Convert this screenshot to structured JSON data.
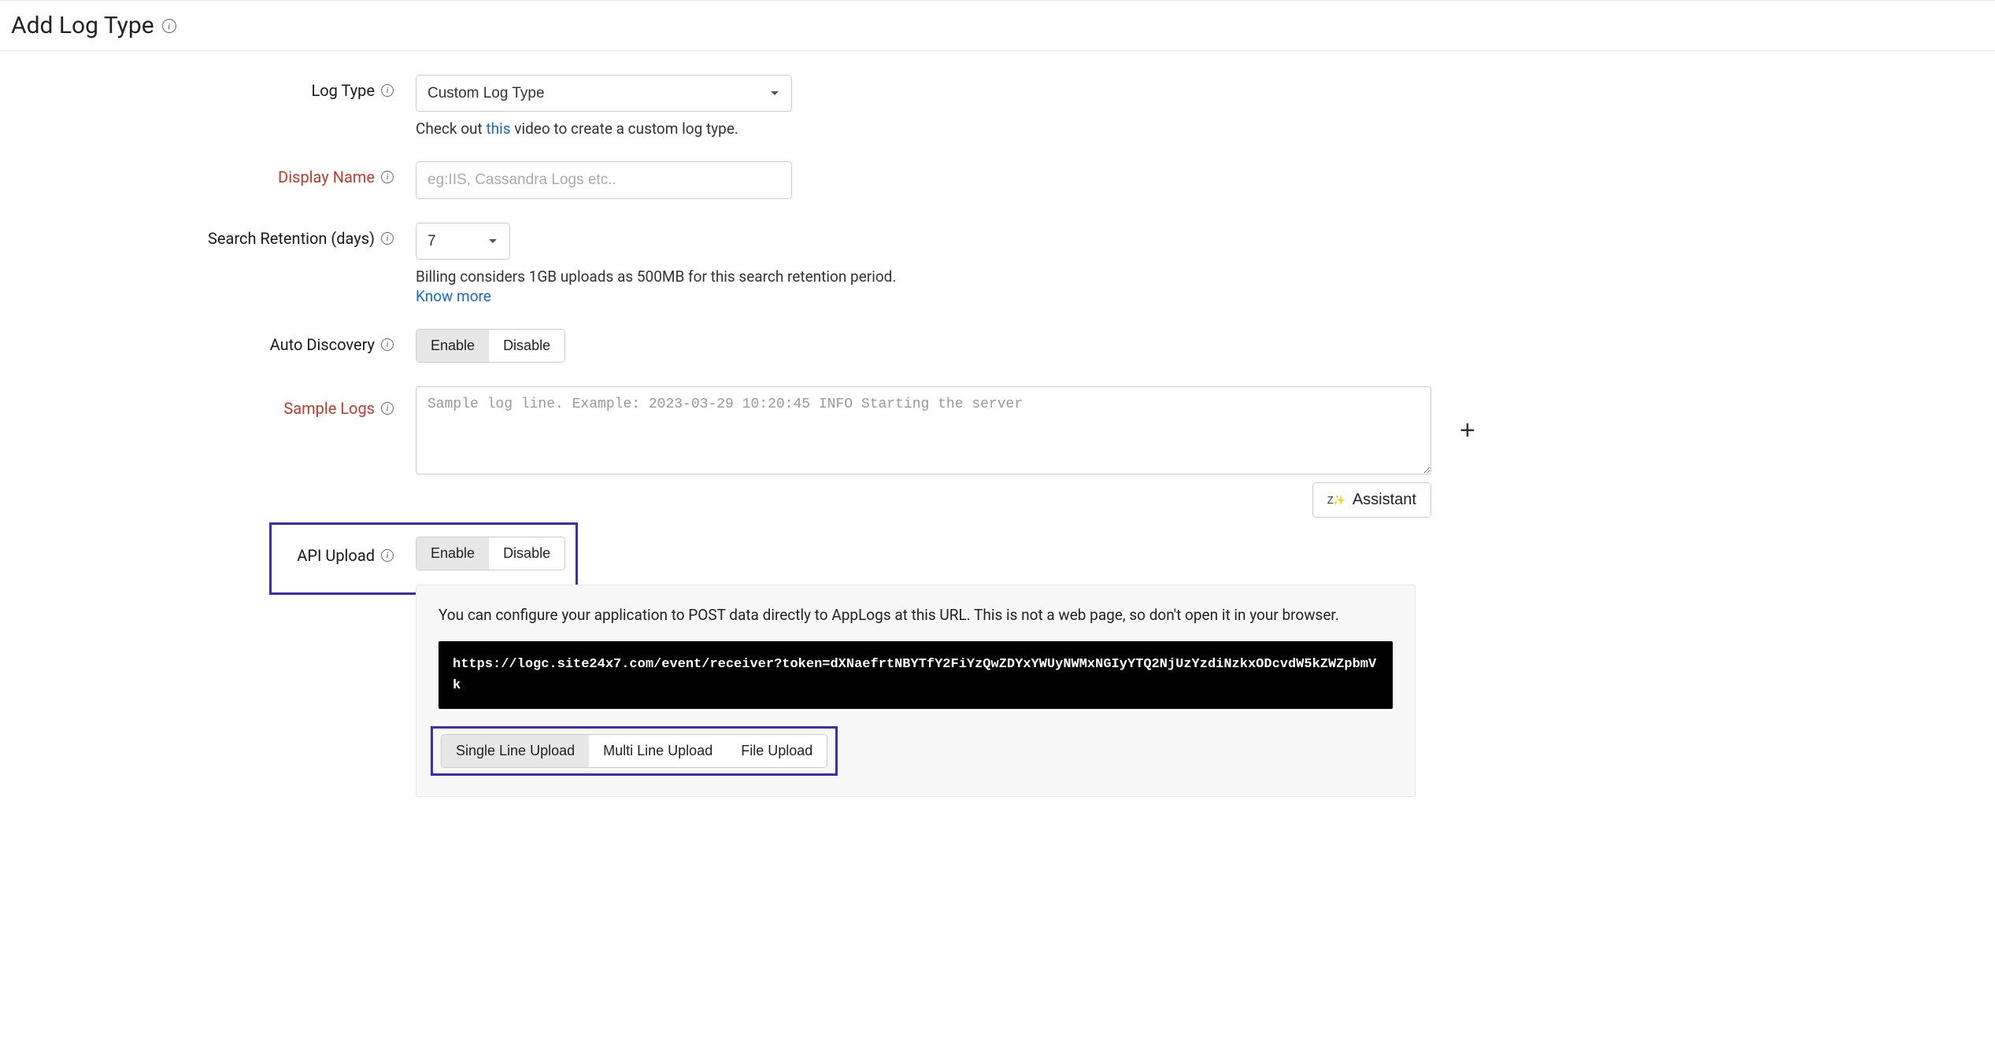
{
  "header": {
    "title": "Add Log Type"
  },
  "form": {
    "log_type": {
      "label": "Log Type",
      "value": "Custom Log Type",
      "help_prefix": "Check out ",
      "help_link": "this",
      "help_suffix": " video to create a custom log type."
    },
    "display_name": {
      "label": "Display Name",
      "placeholder": "eg:IIS, Cassandra Logs etc.."
    },
    "search_retention": {
      "label": "Search Retention (days)",
      "value": "7",
      "help": "Billing considers 1GB uploads as 500MB for this search retention period.",
      "know_more": "Know more"
    },
    "auto_discovery": {
      "label": "Auto Discovery",
      "enable": "Enable",
      "disable": "Disable"
    },
    "sample_logs": {
      "label": "Sample Logs",
      "placeholder": "Sample log line. Example: 2023-03-29 10:20:45 INFO Starting the server",
      "assistant": "Assistant"
    },
    "api_upload": {
      "label": "API Upload",
      "enable": "Enable",
      "disable": "Disable",
      "desc": "You can configure your application to POST data directly to AppLogs at this URL. This is not a web page, so don't open it in your browser.",
      "url": "https://logc.site24x7.com/event/receiver?token=dXNaefrtNBYTfY2FiYzQwZDYxYWUyNWMxNGIyYTQ2NjUzYzdiNzkxODcvdW5kZWZpbmVk",
      "upload_modes": {
        "single": "Single Line Upload",
        "multi": "Multi Line Upload",
        "file": "File Upload"
      }
    }
  }
}
